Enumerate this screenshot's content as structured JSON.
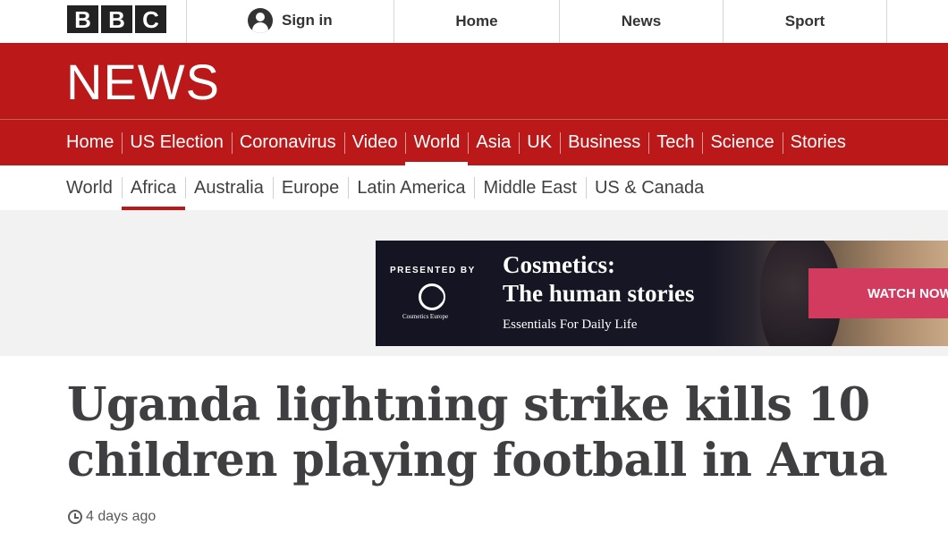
{
  "top_bar": {
    "logo_letters": [
      "B",
      "B",
      "C"
    ],
    "sign_in_label": "Sign in",
    "links": [
      "Home",
      "News",
      "Sport"
    ]
  },
  "banner": {
    "title": "NEWS",
    "primary_nav": [
      "Home",
      "US Election",
      "Coronavirus",
      "Video",
      "World",
      "Asia",
      "UK",
      "Business",
      "Tech",
      "Science",
      "Stories"
    ],
    "active_primary": "World"
  },
  "secondary_nav": {
    "items": [
      "World",
      "Africa",
      "Australia",
      "Europe",
      "Latin America",
      "Middle East",
      "US & Canada"
    ],
    "active": "Africa"
  },
  "ad": {
    "presented_by": "PRESENTED BY",
    "sponsor_name": "Cosmetics Europe",
    "headline_line1": "Cosmetics:",
    "headline_line2": "The human stories",
    "subline": "Essentials For Daily Life",
    "cta_label": "WATCH NOW"
  },
  "article": {
    "headline": "Uganda lightning strike kills 10 children playing football in Arua",
    "timestamp": "4 days ago"
  },
  "colors": {
    "brand_red": "#bb1919",
    "cta_pink": "#d33b5e",
    "headline_text": "#3f3f42"
  }
}
